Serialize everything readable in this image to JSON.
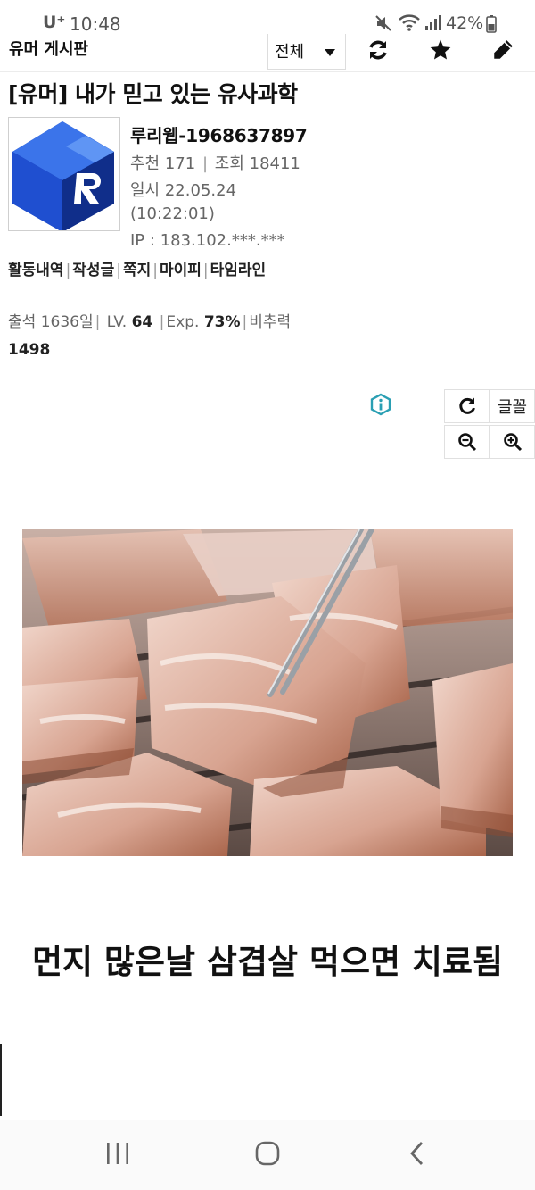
{
  "status_bar": {
    "carrier": "U⁺",
    "time": "10:48",
    "battery": "42%",
    "icons": [
      "mute-icon",
      "wifi-icon",
      "signal-icon",
      "battery-icon"
    ]
  },
  "header": {
    "board_name": "유머 게시판",
    "filter": "전체",
    "icons": [
      "refresh-icon",
      "star-icon",
      "pencil-icon"
    ]
  },
  "post": {
    "title": "[유머] 내가 믿고 있는 유사과학",
    "author": "루리웹-1968637897",
    "recommend_label": "추천",
    "recommend": "171",
    "views_label": "조회",
    "views": "18411",
    "date_label": "일시",
    "date": "22.05.24",
    "time": "(10:22:01)",
    "ip_label": "IP :",
    "ip": "183.102.***.***",
    "caption": "먼지 많은날 삼겹살 먹으면 치료됨"
  },
  "profile": {
    "links": [
      "활동내역",
      "작성글",
      "쪽지",
      "마이피",
      "타임라인"
    ],
    "attendance_label": "출석",
    "attendance": "1636일",
    "level_label": "LV.",
    "level": "64",
    "exp_label": "Exp.",
    "exp": "73%",
    "ratio_label": "비추력",
    "ratio": "1498"
  },
  "controls": {
    "font_label": "글꼴",
    "icons": [
      "info-icon",
      "reload-icon",
      "zoom-out-icon",
      "zoom-in-icon"
    ]
  },
  "colors": {
    "avatar_blue": "#1f4fd0",
    "info_teal": "#2a9fb3"
  }
}
